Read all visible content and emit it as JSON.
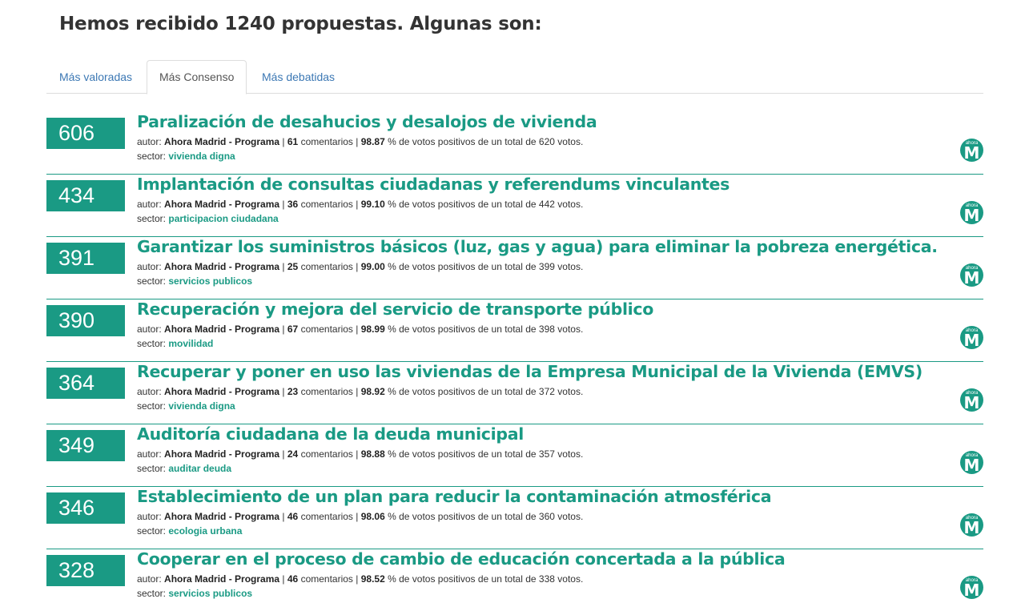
{
  "heading": "Hemos recibido 1240 propuestas. Algunas son:",
  "tabs": [
    {
      "label": "Más valoradas",
      "active": false
    },
    {
      "label": "Más Consenso",
      "active": true
    },
    {
      "label": "Más debatidas",
      "active": false
    }
  ],
  "labels": {
    "author": "autor:",
    "comments": "comentarios",
    "pct_text": "% de votos positivos de un total de",
    "votes_word": "votos.",
    "sector": "sector:",
    "logo_small": "ahora",
    "logo_big": "M"
  },
  "colors": {
    "accent": "#1a9a84",
    "link": "#3c78b4"
  },
  "proposals": [
    {
      "votes": "606",
      "title": "Paralización de desahucios y desalojos de vivienda",
      "author": "Ahora Madrid - Programa",
      "comments": "61",
      "pct": "98.87",
      "total": "620",
      "sector": "vivienda digna"
    },
    {
      "votes": "434",
      "title": "Implantación de consultas ciudadanas y referendums vinculantes",
      "author": "Ahora Madrid - Programa",
      "comments": "36",
      "pct": "99.10",
      "total": "442",
      "sector": "participacion ciudadana"
    },
    {
      "votes": "391",
      "title": "Garantizar los suministros básicos (luz, gas y agua) para eliminar la pobreza energética.",
      "author": "Ahora Madrid - Programa",
      "comments": "25",
      "pct": "99.00",
      "total": "399",
      "sector": "servicios publicos"
    },
    {
      "votes": "390",
      "title": "Recuperación y mejora del servicio de transporte público",
      "author": "Ahora Madrid - Programa",
      "comments": "67",
      "pct": "98.99",
      "total": "398",
      "sector": "movilidad"
    },
    {
      "votes": "364",
      "title": "Recuperar y poner en uso las viviendas de la Empresa Municipal de la Vivienda (EMVS)",
      "author": "Ahora Madrid - Programa",
      "comments": "23",
      "pct": "98.92",
      "total": "372",
      "sector": "vivienda digna"
    },
    {
      "votes": "349",
      "title": "Auditoría ciudadana de la deuda municipal",
      "author": "Ahora Madrid - Programa",
      "comments": "24",
      "pct": "98.88",
      "total": "357",
      "sector": "auditar deuda"
    },
    {
      "votes": "346",
      "title": "Establecimiento de un plan para reducir la contaminación atmosférica",
      "author": "Ahora Madrid - Programa",
      "comments": "46",
      "pct": "98.06",
      "total": "360",
      "sector": "ecologia urbana"
    },
    {
      "votes": "328",
      "title": "Cooperar en el proceso de cambio de educación concertada a la pública",
      "author": "Ahora Madrid - Programa",
      "comments": "46",
      "pct": "98.52",
      "total": "338",
      "sector": "servicios publicos"
    }
  ]
}
